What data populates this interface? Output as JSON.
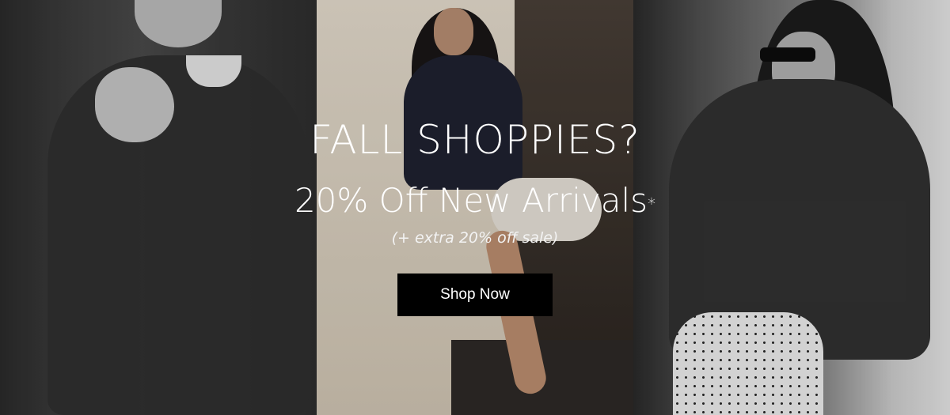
{
  "banner": {
    "headline": "FALL SHOPPIES?",
    "subheadline": "20% Off New Arrivals",
    "subheadline_marker": "*",
    "note": "(+ extra 20% off sale)",
    "cta_label": "Shop Now"
  },
  "colors": {
    "text": "#ffffff",
    "button_bg": "#000000",
    "button_text": "#ffffff"
  }
}
